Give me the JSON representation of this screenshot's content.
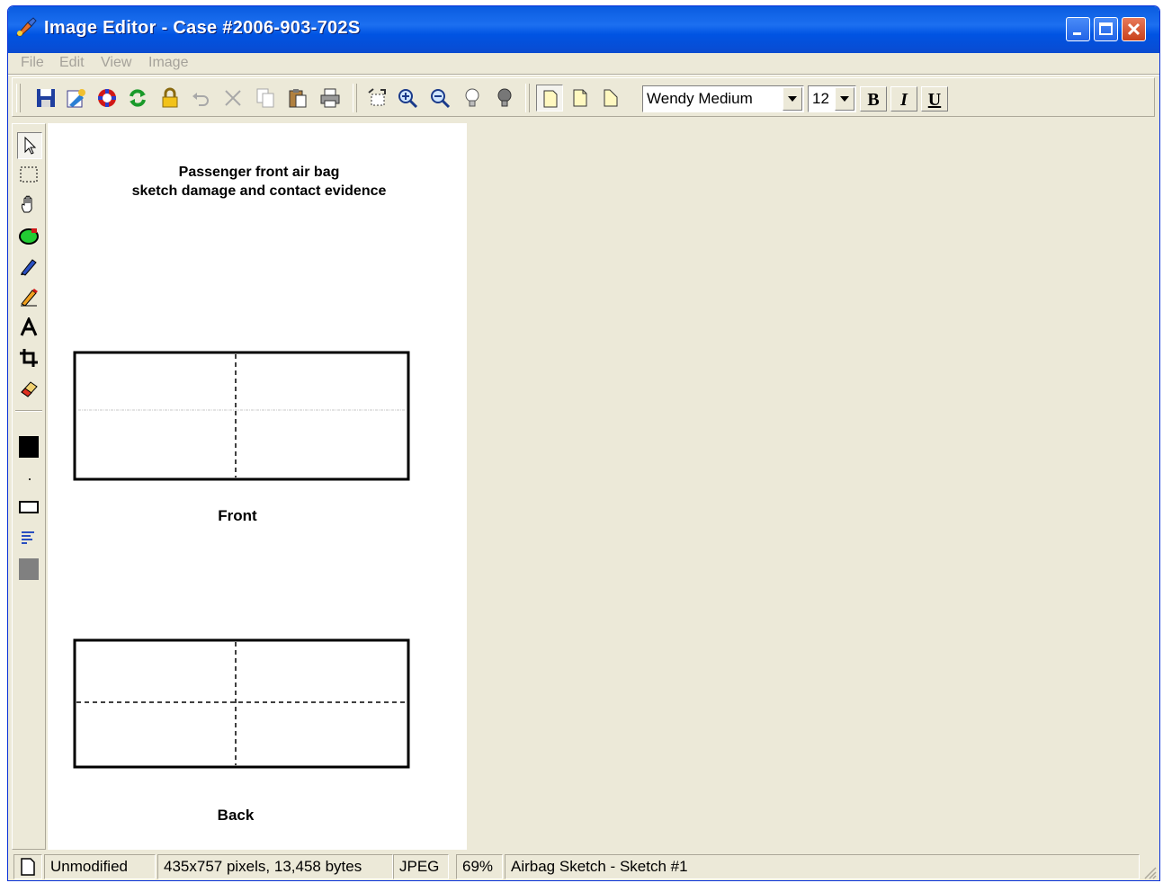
{
  "window": {
    "title": "Image Editor - Case #2006-903-702S"
  },
  "menu": {
    "items": [
      "File",
      "Edit",
      "View",
      "Image"
    ]
  },
  "toolbar": {
    "font_name": "Wendy Medium",
    "font_size": "12",
    "bold_label": "B",
    "italic_label": "I",
    "underline_label": "U"
  },
  "sketch": {
    "title_line1": "Passenger front air bag",
    "title_line2": "sketch damage and contact evidence",
    "front_label": "Front",
    "back_label": "Back"
  },
  "status": {
    "state": "Unmodified",
    "dimensions": "435x757 pixels, 13,458 bytes",
    "format": "JPEG",
    "zoom": "69%",
    "document": "Airbag Sketch - Sketch #1"
  },
  "colors": {
    "title_bar": "#0054e3",
    "window_bg": "#ece9d8",
    "foreground_color": "#000000",
    "fill_color": "#808080"
  }
}
